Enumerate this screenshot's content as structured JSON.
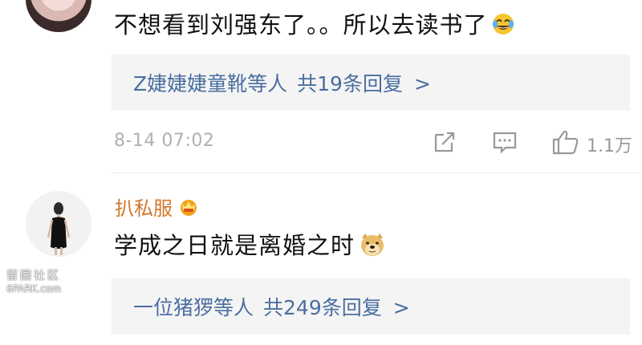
{
  "comment1": {
    "text": "不想看到刘强东了。。所以去读书了",
    "reply_preview": {
      "users": "Z婕婕婕童靴等人",
      "count": "共19条回复",
      "chevron": ">"
    },
    "time": "8-14 07:02",
    "like_count": "1.1万"
  },
  "comment2": {
    "username": "扒私服",
    "text": "学成之日就是离婚之时",
    "reply_preview": {
      "users": "一位猪猡等人",
      "count": "共249条回复",
      "chevron": ">"
    }
  },
  "watermark": {
    "line1": "留园社区",
    "line2": "6PARK.com"
  },
  "colors": {
    "link_blue": "#4a6ea0",
    "username_orange": "#d2772a",
    "reply_bg": "#f4f4f4",
    "meta_gray": "#b0b0b0"
  },
  "icons": [
    "laughing-tears-emoji",
    "share-icon",
    "comment-icon",
    "like-thumb-icon",
    "vip-crown-badge",
    "doge-emoji"
  ]
}
